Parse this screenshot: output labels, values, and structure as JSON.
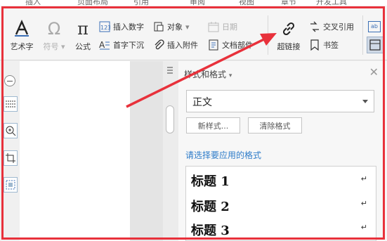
{
  "menubar": {
    "items": [
      "插入",
      "页面布局",
      "引用",
      "审阅",
      "视图",
      "章节",
      "开发工具"
    ]
  },
  "ribbon": {
    "art_text": "艺术字",
    "symbol": "符号",
    "formula": "公式",
    "insert_number": "插入数字",
    "drop_cap": "首字下沉",
    "object": "对象",
    "attachment": "插入附件",
    "date": "日期",
    "doc_parts": "文档部件",
    "hyperlink": "超链接",
    "cross_ref": "交叉引用",
    "bookmark": "书签"
  },
  "panel": {
    "title": "样式和格式",
    "current_style": "正文",
    "new_style_button": "新样式...",
    "clear_format_button": "清除格式",
    "prompt": "请选择要应用的格式",
    "styles": [
      "标题 1",
      "标题 2",
      "标题 3"
    ],
    "return_mark": "↵"
  },
  "colors": {
    "annotation": "#e8313b",
    "prompt": "#2e7cc9",
    "accent": "#3b6fb6"
  }
}
